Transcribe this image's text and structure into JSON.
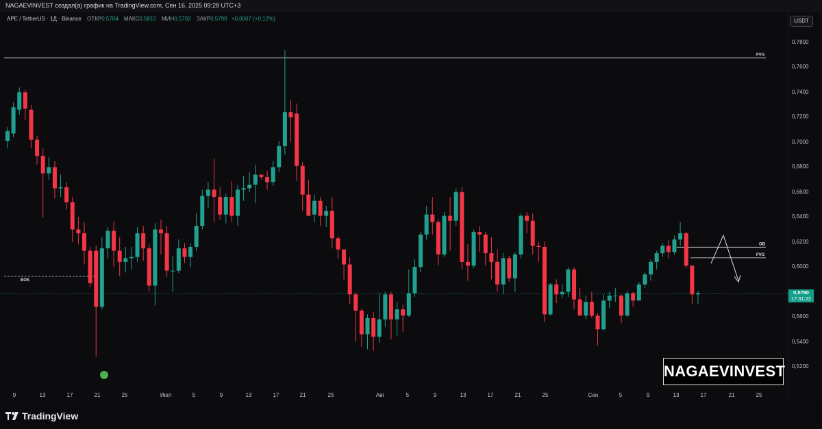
{
  "header": {
    "title": "NAGAEVINVEST создал(а) график на TradingView.com, Сен 16, 2025 09:28 UTC+3"
  },
  "legend": {
    "symbol": "APE / TetherUS · 1Д · Binance",
    "open_label": "ОТКР",
    "open": "0,5784",
    "high_label": "МАКС",
    "high": "0,5810",
    "low_label": "МИН",
    "low": "0,5702",
    "close_label": "ЗАКР",
    "close": "0,5790",
    "change": "+0,0007 (+0,12%)"
  },
  "currency": "USDT",
  "colors": {
    "up": "#22a08f",
    "down": "#f23645",
    "background": "#0c0c0f",
    "price_line": "#149e8a"
  },
  "price_axis": [
    "0,7800",
    "0,7600",
    "0,7400",
    "0,7200",
    "0,7000",
    "0,6800",
    "0,6600",
    "0,6400",
    "0,6200",
    "0,6000",
    "0,5800",
    "0,5600",
    "0,5400",
    "0,5200"
  ],
  "current_price": {
    "value": "0,5790",
    "countdown": "17:31:22"
  },
  "time_axis": [
    "9",
    "13",
    "17",
    "21",
    "25",
    "Июл",
    "5",
    "9",
    "13",
    "17",
    "21",
    "25",
    "Авг",
    "5",
    "9",
    "13",
    "17",
    "21",
    "25",
    "Сен",
    "5",
    "9",
    "13",
    "17",
    "21",
    "25"
  ],
  "annotations": {
    "fvg_top": "FVG",
    "ob": "OB",
    "fvg_right": "FVG",
    "bos": "BOS"
  },
  "watermark": "NAGAEVINVEST",
  "footer": {
    "logo": "TradingView"
  },
  "chart_data": {
    "type": "candlestick",
    "y_range": [
      0.512,
      0.788
    ],
    "candles": [
      [
        0.701,
        0.709,
        0.695,
        0.712
      ],
      [
        0.707,
        0.728,
        0.704,
        0.732
      ],
      [
        0.726,
        0.74,
        0.722,
        0.744
      ],
      [
        0.74,
        0.727,
        0.718,
        0.742
      ],
      [
        0.726,
        0.702,
        0.695,
        0.73
      ],
      [
        0.702,
        0.689,
        0.682,
        0.705
      ],
      [
        0.689,
        0.675,
        0.64,
        0.695
      ],
      [
        0.675,
        0.68,
        0.67,
        0.688
      ],
      [
        0.68,
        0.663,
        0.655,
        0.685
      ],
      [
        0.663,
        0.664,
        0.656,
        0.674
      ],
      [
        0.664,
        0.652,
        0.646,
        0.668
      ],
      [
        0.652,
        0.63,
        0.62,
        0.656
      ],
      [
        0.63,
        0.627,
        0.618,
        0.64
      ],
      [
        0.627,
        0.613,
        0.602,
        0.636
      ],
      [
        0.613,
        0.587,
        0.584,
        0.616
      ],
      [
        0.613,
        0.568,
        0.528,
        0.617
      ],
      [
        0.568,
        0.615,
        0.566,
        0.624
      ],
      [
        0.615,
        0.629,
        0.607,
        0.632
      ],
      [
        0.629,
        0.613,
        0.6,
        0.636
      ],
      [
        0.613,
        0.604,
        0.593,
        0.624
      ],
      [
        0.604,
        0.607,
        0.596,
        0.616
      ],
      [
        0.607,
        0.608,
        0.598,
        0.616
      ],
      [
        0.608,
        0.627,
        0.604,
        0.632
      ],
      [
        0.627,
        0.615,
        0.605,
        0.633
      ],
      [
        0.615,
        0.585,
        0.58,
        0.618
      ],
      [
        0.585,
        0.63,
        0.569,
        0.635
      ],
      [
        0.63,
        0.627,
        0.61,
        0.638
      ],
      [
        0.627,
        0.597,
        0.592,
        0.633
      ],
      [
        0.597,
        0.597,
        0.58,
        0.609
      ],
      [
        0.597,
        0.615,
        0.595,
        0.622
      ],
      [
        0.615,
        0.608,
        0.603,
        0.619
      ],
      [
        0.608,
        0.616,
        0.6,
        0.619
      ],
      [
        0.616,
        0.633,
        0.613,
        0.643
      ],
      [
        0.633,
        0.657,
        0.63,
        0.662
      ],
      [
        0.657,
        0.662,
        0.647,
        0.668
      ],
      [
        0.662,
        0.656,
        0.636,
        0.687
      ],
      [
        0.656,
        0.642,
        0.638,
        0.664
      ],
      [
        0.642,
        0.656,
        0.635,
        0.659
      ],
      [
        0.656,
        0.641,
        0.636,
        0.669
      ],
      [
        0.641,
        0.662,
        0.633,
        0.666
      ],
      [
        0.662,
        0.663,
        0.653,
        0.673
      ],
      [
        0.663,
        0.666,
        0.66,
        0.676
      ],
      [
        0.666,
        0.674,
        0.651,
        0.682
      ],
      [
        0.674,
        0.672,
        0.67,
        0.674
      ],
      [
        0.672,
        0.668,
        0.662,
        0.677
      ],
      [
        0.668,
        0.68,
        0.665,
        0.685
      ],
      [
        0.68,
        0.697,
        0.676,
        0.701
      ],
      [
        0.697,
        0.724,
        0.69,
        0.774
      ],
      [
        0.724,
        0.72,
        0.7,
        0.734
      ],
      [
        0.723,
        0.681,
        0.669,
        0.731
      ],
      [
        0.681,
        0.658,
        0.645,
        0.684
      ],
      [
        0.658,
        0.641,
        0.641,
        0.67
      ],
      [
        0.642,
        0.653,
        0.636,
        0.658
      ],
      [
        0.653,
        0.641,
        0.633,
        0.656
      ],
      [
        0.641,
        0.645,
        0.632,
        0.649
      ],
      [
        0.645,
        0.623,
        0.615,
        0.656
      ],
      [
        0.623,
        0.614,
        0.607,
        0.625
      ],
      [
        0.614,
        0.602,
        0.59,
        0.614
      ],
      [
        0.602,
        0.578,
        0.57,
        0.608
      ],
      [
        0.578,
        0.565,
        0.54,
        0.58
      ],
      [
        0.565,
        0.546,
        0.536,
        0.567
      ],
      [
        0.546,
        0.559,
        0.534,
        0.562
      ],
      [
        0.559,
        0.544,
        0.533,
        0.564
      ],
      [
        0.544,
        0.558,
        0.539,
        0.579
      ],
      [
        0.558,
        0.578,
        0.552,
        0.58
      ],
      [
        0.578,
        0.558,
        0.542,
        0.58
      ],
      [
        0.558,
        0.566,
        0.545,
        0.572
      ],
      [
        0.566,
        0.561,
        0.548,
        0.57
      ],
      [
        0.561,
        0.579,
        0.56,
        0.598
      ],
      [
        0.579,
        0.6,
        0.576,
        0.606
      ],
      [
        0.6,
        0.626,
        0.596,
        0.628
      ],
      [
        0.626,
        0.642,
        0.622,
        0.649
      ],
      [
        0.642,
        0.636,
        0.626,
        0.656
      ],
      [
        0.636,
        0.61,
        0.601,
        0.638
      ],
      [
        0.61,
        0.641,
        0.608,
        0.644
      ],
      [
        0.641,
        0.637,
        0.613,
        0.656
      ],
      [
        0.637,
        0.66,
        0.633,
        0.663
      ],
      [
        0.66,
        0.604,
        0.598,
        0.664
      ],
      [
        0.604,
        0.601,
        0.589,
        0.618
      ],
      [
        0.601,
        0.628,
        0.599,
        0.63
      ],
      [
        0.628,
        0.626,
        0.612,
        0.633
      ],
      [
        0.626,
        0.611,
        0.601,
        0.628
      ],
      [
        0.611,
        0.604,
        0.59,
        0.624
      ],
      [
        0.604,
        0.586,
        0.58,
        0.614
      ],
      [
        0.586,
        0.607,
        0.578,
        0.611
      ],
      [
        0.607,
        0.591,
        0.588,
        0.609
      ],
      [
        0.591,
        0.61,
        0.58,
        0.612
      ],
      [
        0.61,
        0.641,
        0.607,
        0.643
      ],
      [
        0.641,
        0.637,
        0.627,
        0.644
      ],
      [
        0.637,
        0.617,
        0.61,
        0.643
      ],
      [
        0.617,
        0.616,
        0.604,
        0.62
      ],
      [
        0.616,
        0.562,
        0.556,
        0.62
      ],
      [
        0.562,
        0.586,
        0.561,
        0.587
      ],
      [
        0.586,
        0.578,
        0.571,
        0.59
      ],
      [
        0.578,
        0.58,
        0.575,
        0.586
      ],
      [
        0.58,
        0.598,
        0.576,
        0.6
      ],
      [
        0.598,
        0.574,
        0.566,
        0.6
      ],
      [
        0.574,
        0.561,
        0.561,
        0.583
      ],
      [
        0.561,
        0.572,
        0.558,
        0.577
      ],
      [
        0.572,
        0.561,
        0.559,
        0.58
      ],
      [
        0.561,
        0.55,
        0.537,
        0.563
      ],
      [
        0.55,
        0.573,
        0.549,
        0.578
      ],
      [
        0.573,
        0.577,
        0.567,
        0.58
      ],
      [
        0.577,
        0.577,
        0.572,
        0.583
      ],
      [
        0.577,
        0.561,
        0.555,
        0.578
      ],
      [
        0.561,
        0.579,
        0.56,
        0.581
      ],
      [
        0.579,
        0.573,
        0.568,
        0.58
      ],
      [
        0.573,
        0.586,
        0.573,
        0.588
      ],
      [
        0.586,
        0.594,
        0.583,
        0.596
      ],
      [
        0.594,
        0.604,
        0.589,
        0.606
      ],
      [
        0.604,
        0.611,
        0.598,
        0.613
      ],
      [
        0.611,
        0.617,
        0.608,
        0.619
      ],
      [
        0.617,
        0.612,
        0.607,
        0.622
      ],
      [
        0.612,
        0.622,
        0.61,
        0.625
      ],
      [
        0.622,
        0.627,
        0.617,
        0.636
      ],
      [
        0.627,
        0.601,
        0.599,
        0.628
      ],
      [
        0.601,
        0.578,
        0.57,
        0.601
      ],
      [
        0.578,
        0.579,
        0.57,
        0.581
      ]
    ]
  }
}
